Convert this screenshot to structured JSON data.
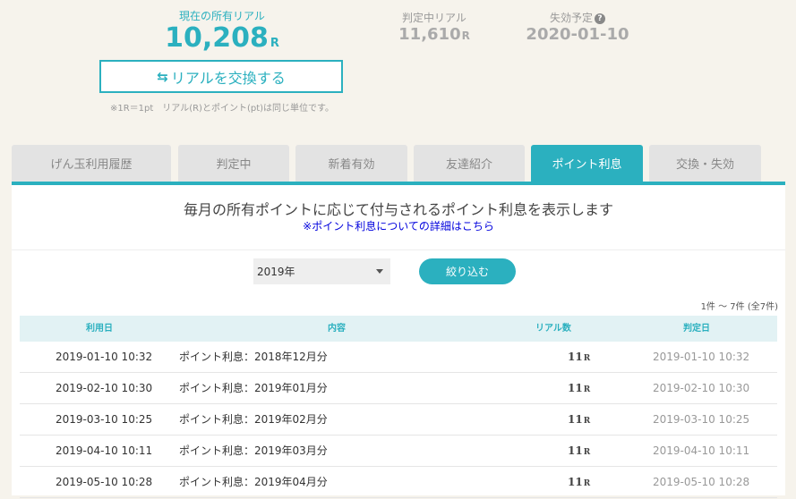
{
  "summary": {
    "current_label": "現在の所有リアル",
    "current_value": "10,208",
    "current_unit": "R",
    "judging_label": "判定中リアル",
    "judging_value": "11,610",
    "judging_unit": "R",
    "expiry_label": "失効予定",
    "expiry_help": "?",
    "expiry_value": "2020-01-10"
  },
  "exchange": {
    "icon": "refresh-icon",
    "icon_glyph": "⇆",
    "label": "リアルを交換する",
    "note": "※1R＝1pt　リアル(R)とポイント(pt)は同じ単位です。"
  },
  "tabs": [
    {
      "label": "げん玉利用履歴",
      "active": false
    },
    {
      "label": "判定中",
      "active": false
    },
    {
      "label": "新着有効",
      "active": false
    },
    {
      "label": "友達紹介",
      "active": false
    },
    {
      "label": "ポイント利息",
      "active": true
    },
    {
      "label": "交換・失効",
      "active": false
    }
  ],
  "panel": {
    "headline": "毎月の所有ポイントに応じて付与されるポイント利息を表示します",
    "detail_link": "※ポイント利息についての詳細はこちら"
  },
  "filter": {
    "year": "2019年",
    "button": "絞り込む"
  },
  "count_text": "1件 〜 7件 (全7件)",
  "table": {
    "headers": [
      "利用日",
      "内容",
      "リアル数",
      "判定日"
    ],
    "unit": "R",
    "rows": [
      {
        "date": "2019-01-10 10:32",
        "content": "ポイント利息：2018年12月分",
        "amount": "11",
        "judged": "2019-01-10 10:32"
      },
      {
        "date": "2019-02-10 10:30",
        "content": "ポイント利息：2019年01月分",
        "amount": "11",
        "judged": "2019-02-10 10:30"
      },
      {
        "date": "2019-03-10 10:25",
        "content": "ポイント利息：2019年02月分",
        "amount": "11",
        "judged": "2019-03-10 10:25"
      },
      {
        "date": "2019-04-10 10:11",
        "content": "ポイント利息：2019年03月分",
        "amount": "11",
        "judged": "2019-04-10 10:11"
      },
      {
        "date": "2019-05-10 10:28",
        "content": "ポイント利息：2019年04月分",
        "amount": "11",
        "judged": "2019-05-10 10:28"
      }
    ]
  },
  "colors": {
    "accent": "#2bb0bf",
    "tab_inactive": "#e3e3e3",
    "background": "#f6f3ec",
    "link": "#0000dd"
  }
}
